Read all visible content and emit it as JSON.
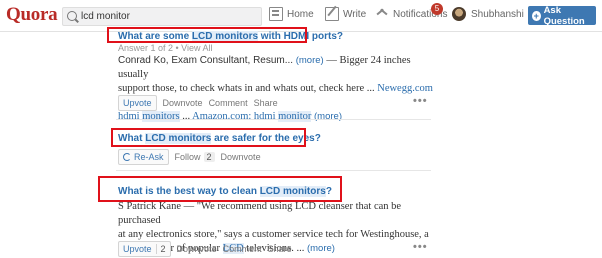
{
  "header": {
    "logo": "Quora",
    "search_value": "lcd monitor",
    "nav_home": "Home",
    "nav_write": "Write",
    "nav_notifications": "Notifications",
    "notification_count": "5",
    "user_name": "Shubhanshi",
    "ask_button": "Ask Question"
  },
  "q1": {
    "title_pre": "What are some ",
    "title_hl": "LCD monitors",
    "title_post": " with HDMI ports?",
    "meta": "Answer 1 of 2 • View All",
    "author": "Conrad Ko, Exam Consultant, Resum...",
    "more1": "(more)",
    "line1": " — Bigger 24 inches usually",
    "line2": "support those, to check whats in and whats out, check here  ... ",
    "link1": "Newegg.com -",
    "line3_pre": "hdmi ",
    "line3_hl": "monitors",
    "line3_mid": " ... ",
    "link2": "Amazon.com: hdmi ",
    "link2_hl": "monitor",
    "more2": "(more)",
    "upvote": "Upvote",
    "downvote": "Downvote",
    "comment": "Comment",
    "share": "Share"
  },
  "q2": {
    "title_pre": "What ",
    "title_hl": "LCD monitors",
    "title_post": " are safer for the eyes?",
    "reask": "Re-Ask",
    "follow": "Follow",
    "follow_count": "2",
    "downvote": "Downvote"
  },
  "q3": {
    "title_pre": "What is the best way to clean ",
    "title_hl": "LCD monitors",
    "title_post": "?",
    "line1": "S Patrick Kane — \"We recommend using LCD cleanser that can be purchased",
    "line2": "at any electronics store,\" says a customer service tech for Westinghouse, a",
    "line3_pre": "manufacturer of popular ",
    "line3_hl": "LCD",
    "line3_post": " televisions. ... ",
    "more": "(more)",
    "upvote": "Upvote",
    "upvote_count": "2",
    "downvote": "Downvote",
    "comment": "Comment",
    "share": "Share"
  },
  "overflow": "•••",
  "colors": {
    "brand": "#b92b27",
    "link": "#2b6dad",
    "annotation": "#e0111a",
    "button": "#3e78b2"
  }
}
